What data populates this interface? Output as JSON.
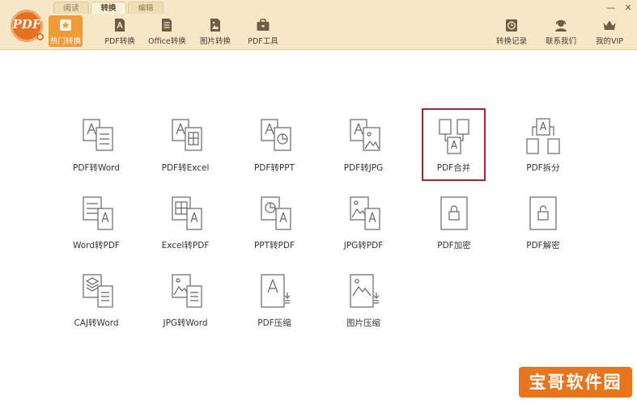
{
  "app": {
    "logo_text": "PDF"
  },
  "tabs": [
    {
      "label": "阅读",
      "active": false
    },
    {
      "label": "转换",
      "active": true
    },
    {
      "label": "编辑",
      "active": false
    }
  ],
  "toolbar": {
    "left": [
      {
        "label": "热门转换",
        "icon": "star-icon",
        "active": true
      },
      {
        "label": "PDF转换",
        "icon": "pdf-icon",
        "active": false
      },
      {
        "label": "Office转换",
        "icon": "document-icon",
        "active": false
      },
      {
        "label": "图片转换",
        "icon": "image-icon",
        "active": false
      },
      {
        "label": "PDF工具",
        "icon": "toolbox-icon",
        "active": false
      }
    ],
    "right": [
      {
        "label": "转换记录",
        "icon": "clock-icon"
      },
      {
        "label": "联系我们",
        "icon": "headset-icon"
      },
      {
        "label": "我的VIP",
        "icon": "crown-icon"
      }
    ]
  },
  "window_controls": {
    "minimize": "—",
    "close": "✕"
  },
  "grid": {
    "rows": [
      [
        {
          "label": "PDF转Word",
          "icon": "pdf-to-word-icon"
        },
        {
          "label": "PDF转Excel",
          "icon": "pdf-to-excel-icon"
        },
        {
          "label": "PDF转PPT",
          "icon": "pdf-to-ppt-icon"
        },
        {
          "label": "PDF转JPG",
          "icon": "pdf-to-jpg-icon"
        },
        {
          "label": "PDF合并",
          "icon": "pdf-merge-icon",
          "selected": true
        },
        {
          "label": "PDF拆分",
          "icon": "pdf-split-icon"
        }
      ],
      [
        {
          "label": "Word转PDF",
          "icon": "word-to-pdf-icon"
        },
        {
          "label": "Excel转PDF",
          "icon": "excel-to-pdf-icon"
        },
        {
          "label": "PPT转PDF",
          "icon": "ppt-to-pdf-icon"
        },
        {
          "label": "JPG转PDF",
          "icon": "jpg-to-pdf-icon"
        },
        {
          "label": "PDF加密",
          "icon": "pdf-encrypt-icon"
        },
        {
          "label": "PDF解密",
          "icon": "pdf-decrypt-icon"
        }
      ],
      [
        {
          "label": "CAJ转Word",
          "icon": "caj-to-word-icon"
        },
        {
          "label": "JPG转Word",
          "icon": "jpg-to-word-icon"
        },
        {
          "label": "PDF压缩",
          "icon": "pdf-compress-icon"
        },
        {
          "label": "图片压缩",
          "icon": "image-compress-icon"
        }
      ]
    ]
  },
  "watermark": {
    "text": "宝哥软件园"
  },
  "colors": {
    "header_bg": "#f6e7c6",
    "accent": "#f09a3a",
    "selection_border": "#a5282e",
    "icon_stroke": "#666666",
    "watermark_bg": "#e8751e"
  }
}
